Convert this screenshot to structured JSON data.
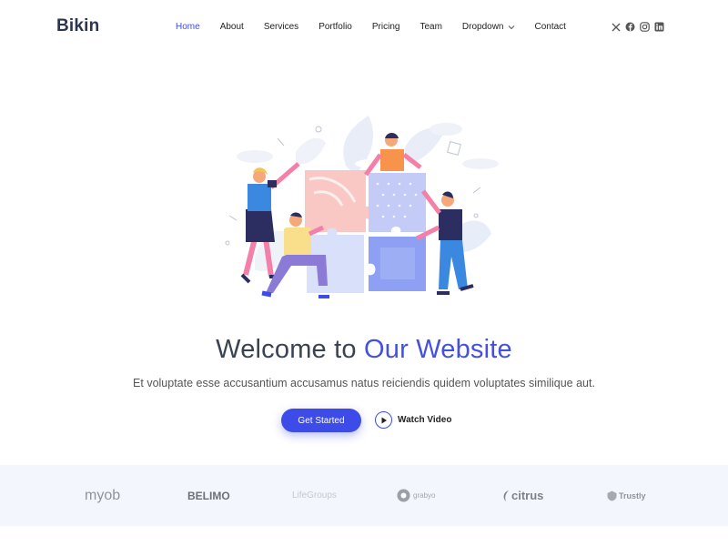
{
  "header": {
    "logo": "Bikin",
    "nav": [
      {
        "label": "Home",
        "active": true
      },
      {
        "label": "About"
      },
      {
        "label": "Services"
      },
      {
        "label": "Portfolio"
      },
      {
        "label": "Pricing"
      },
      {
        "label": "Team"
      },
      {
        "label": "Dropdown",
        "has_dropdown": true
      },
      {
        "label": "Contact"
      }
    ],
    "socials": [
      "x-icon",
      "facebook-icon",
      "instagram-icon",
      "linkedin-icon"
    ]
  },
  "hero": {
    "title_start": "Welcome to ",
    "title_accent": "Our Website",
    "subtitle": "Et voluptate esse accusantium accusamus natus reiciendis quidem voluptates similique aut.",
    "cta_primary": "Get Started",
    "cta_secondary": "Watch Video"
  },
  "clients": [
    "myob",
    "BELIMO",
    "LifeGroups",
    "grabyo",
    "citrus",
    "Trustly"
  ],
  "colors": {
    "accent": "#3d4ce8",
    "heading": "#3a4354",
    "clients_bg": "#f4f6fd"
  }
}
